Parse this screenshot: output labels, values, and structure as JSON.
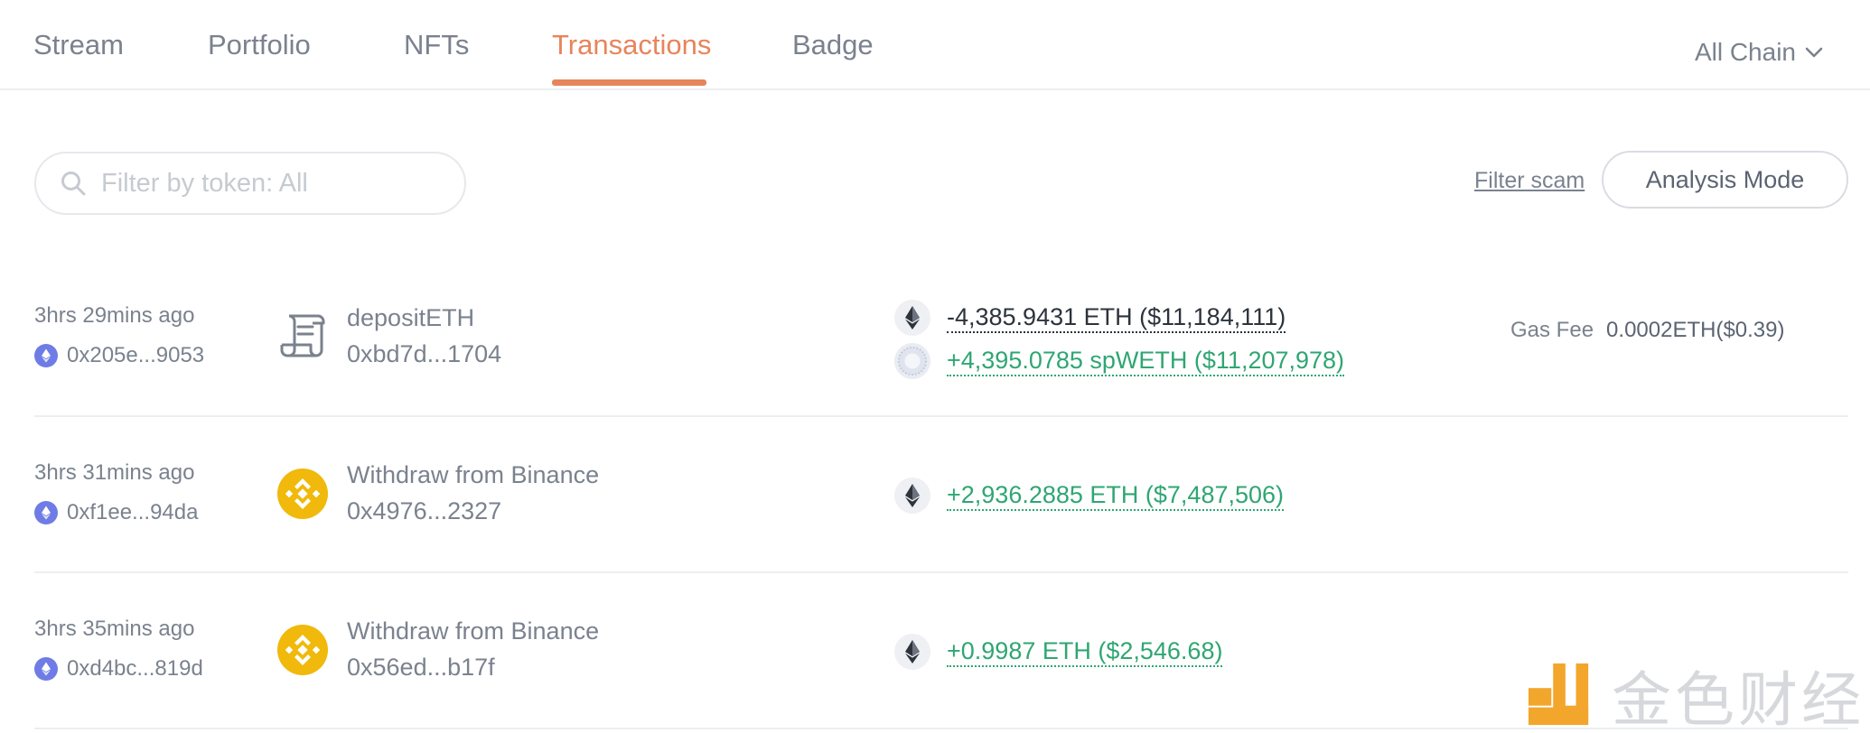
{
  "tabs": [
    {
      "label": "Stream"
    },
    {
      "label": "Portfolio"
    },
    {
      "label": "NFTs"
    },
    {
      "label": "Transactions"
    },
    {
      "label": "Badge"
    }
  ],
  "active_tab": "Transactions",
  "chain_selector": {
    "label": "All Chain"
  },
  "filter": {
    "placeholder": "Filter by token: All",
    "scam_label": "Filter scam",
    "analysis_label": "Analysis Mode"
  },
  "transactions": [
    {
      "time": "3hrs 29mins ago",
      "address": "0x205e...9053",
      "op": "depositETH",
      "op_address": "0xbd7d...1704",
      "icon": "contract-scroll-icon",
      "amounts": [
        {
          "text": "-4,385.9431 ETH ($11,184,111)",
          "token_icon": "eth-token-icon",
          "direction": "out"
        },
        {
          "text": "+4,395.0785 spWETH ($11,207,978)",
          "token_icon": "spweth-token-icon",
          "direction": "in"
        }
      ],
      "gas_label": "Gas Fee",
      "gas_value": "0.0002ETH($0.39)"
    },
    {
      "time": "3hrs 31mins ago",
      "address": "0xf1ee...94da",
      "op": "Withdraw from Binance",
      "op_address": "0x4976...2327",
      "icon": "binance-icon",
      "amounts": [
        {
          "text": "+2,936.2885 ETH ($7,487,506)",
          "token_icon": "eth-token-icon",
          "direction": "in"
        }
      ]
    },
    {
      "time": "3hrs 35mins ago",
      "address": "0xd4bc...819d",
      "op": "Withdraw from Binance",
      "op_address": "0x56ed...b17f",
      "icon": "binance-icon",
      "amounts": [
        {
          "text": "+0.9987 ETH ($2,546.68)",
          "token_icon": "eth-token-icon",
          "direction": "in"
        }
      ]
    }
  ],
  "watermark": {
    "text": "金色财经"
  },
  "colors": {
    "accent": "#e8845c",
    "positive": "#2fa672",
    "negative": "#2d333c",
    "binance": "#f0b90b",
    "eth_badge": "#6f7ce6"
  }
}
